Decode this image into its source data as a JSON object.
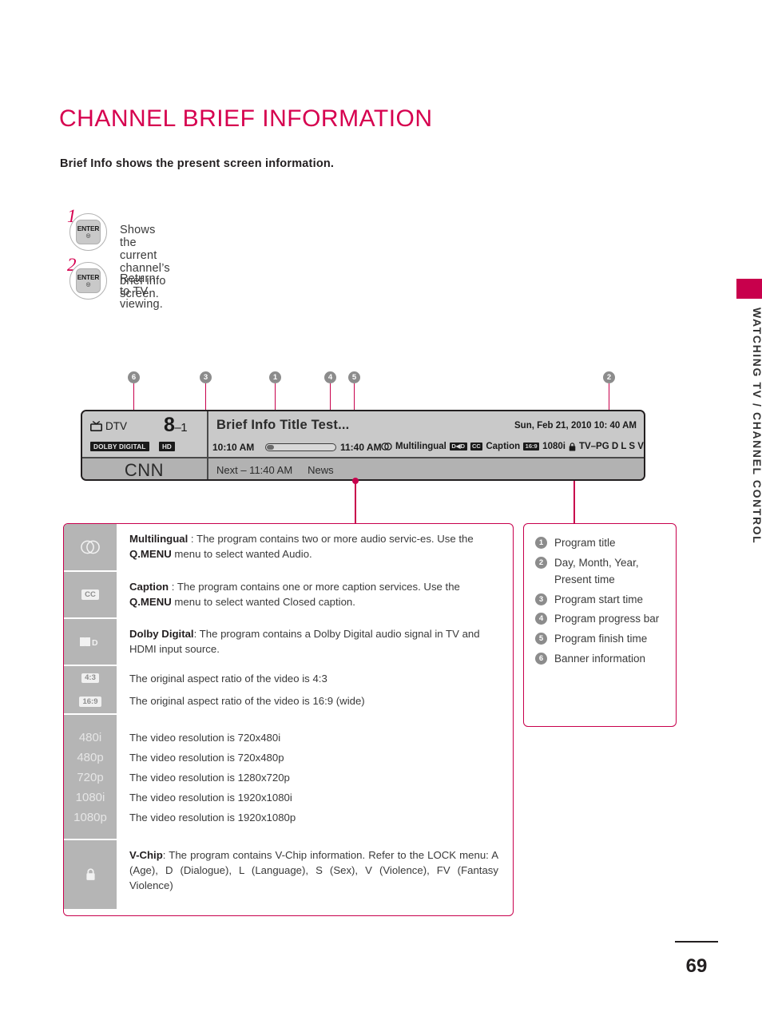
{
  "page": {
    "title": "CHANNEL BRIEF INFORMATION",
    "intro": "Brief Info shows the present screen information.",
    "side_tab": "WATCHING TV / CHANNEL CONTROL",
    "page_number": "69",
    "accent_color": "#c8004c",
    "title_color": "#d6004f"
  },
  "steps": [
    {
      "num": "1",
      "key_label": "ENTER",
      "key_icon": "enter-dot-icon",
      "text": "Shows the current channel’s brief info screen."
    },
    {
      "num": "2",
      "key_label": "ENTER",
      "key_icon": "enter-dot-icon",
      "text": "Return to TV viewing."
    }
  ],
  "banner": {
    "source_icon": "tv-icon",
    "source_label": "DTV",
    "channel_number": "8",
    "channel_sub": "–1",
    "badges": [
      "DOLBY DIGITAL",
      "HD"
    ],
    "channel_name": "CNN",
    "program_title": "Brief Info Title Test...",
    "date_time": "Sun, Feb 21, 2010 10: 40 AM",
    "start_time": "10:10 AM",
    "end_time": "11:40 AM",
    "progress_percent": 9,
    "info_icons": [
      {
        "icon": "multilingual-icon",
        "label": "Multilingual"
      },
      {
        "icon": "dolby-digital-icon",
        "label": ""
      },
      {
        "icon": "cc-icon",
        "label": "Caption"
      },
      {
        "icon": "aspect-16-9-icon",
        "label": "1080i"
      },
      {
        "icon": "lock-icon",
        "label": "TV–PG D L S V"
      }
    ],
    "dolby_mini": "D◀D",
    "cc_mini": "CC",
    "aspect_mini": "16:9",
    "next_prefix": "Next – 11:40 AM",
    "next_program": "News"
  },
  "callout_markers": [
    "6",
    "3",
    "1",
    "4",
    "5",
    "2"
  ],
  "legend_rows": [
    {
      "icon": "multilingual-icon",
      "icon_text": "",
      "parts": [
        {
          "bold": "Multilingual"
        },
        {
          "text": " : The program contains two or more audio servic-es. Use the "
        },
        {
          "bold": "Q.MENU"
        },
        {
          "text": " menu to select wanted Audio."
        }
      ]
    },
    {
      "icon": "cc-icon",
      "icon_text": "CC",
      "parts": [
        {
          "bold": "Caption"
        },
        {
          "text": " : The program contains one or more caption services. Use the "
        },
        {
          "bold": "Q.MENU"
        },
        {
          "text": " menu to select wanted Closed caption."
        }
      ]
    },
    {
      "icon": "dolby-digital-icon",
      "icon_text": "D◀D",
      "parts": [
        {
          "bold": "Dolby Digital"
        },
        {
          "text": ": The program contains a Dolby Digital audio signal in TV and HDMI input source."
        }
      ]
    }
  ],
  "aspect_rows": [
    {
      "icon": "aspect-4-3-icon",
      "chip": "4:3",
      "text": "The original aspect ratio of the video is 4:3"
    },
    {
      "icon": "aspect-16-9-icon",
      "chip": "16:9",
      "text": "The original aspect ratio of the video is 16:9 (wide)"
    }
  ],
  "resolution_rows": [
    {
      "chip": "480i",
      "text": "The video resolution is 720x480i"
    },
    {
      "chip": "480p",
      "text": "The video resolution is 720x480p"
    },
    {
      "chip": "720p",
      "text": "The video resolution is 1280x720p"
    },
    {
      "chip": "1080i",
      "text": "The video resolution is 1920x1080i"
    },
    {
      "chip": "1080p",
      "text": "The video resolution is 1920x1080p"
    }
  ],
  "vchip_row": {
    "icon": "lock-icon",
    "bold": "V-Chip",
    "text": ": The program contains V-Chip information. Refer to the LOCK menu: A (Age), D (Dialogue), L (Language), S (Sex), V (Violence), FV (Fantasy Violence)"
  },
  "numbered_legend": [
    {
      "num": "1",
      "label": "Program title"
    },
    {
      "num": "2",
      "label": "Day, Month, Year, Present time"
    },
    {
      "num": "3",
      "label": "Program start time"
    },
    {
      "num": "4",
      "label": "Program progress bar"
    },
    {
      "num": "5",
      "label": "Program finish time"
    },
    {
      "num": "6",
      "label": "Banner information"
    }
  ]
}
